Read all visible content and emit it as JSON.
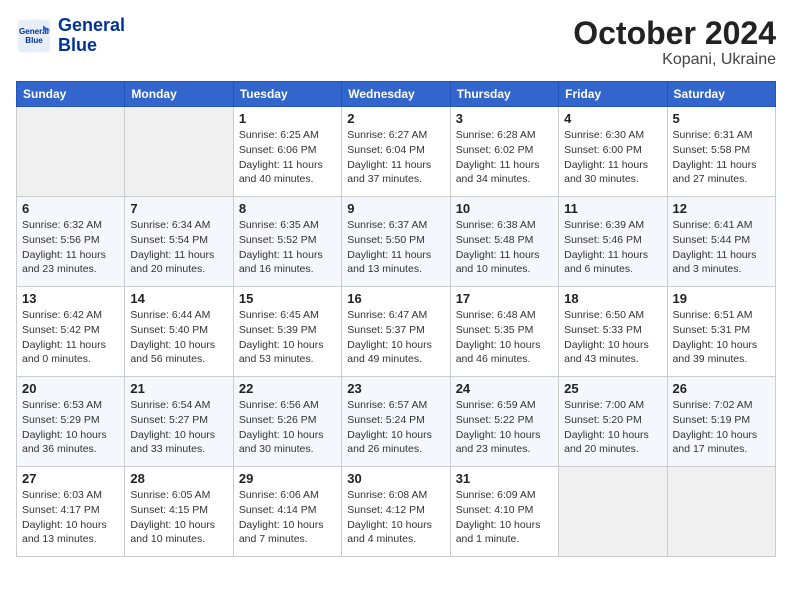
{
  "header": {
    "logo_line1": "General",
    "logo_line2": "Blue",
    "month": "October 2024",
    "location": "Kopani, Ukraine"
  },
  "weekdays": [
    "Sunday",
    "Monday",
    "Tuesday",
    "Wednesday",
    "Thursday",
    "Friday",
    "Saturday"
  ],
  "weeks": [
    [
      {
        "day": "",
        "info": ""
      },
      {
        "day": "",
        "info": ""
      },
      {
        "day": "1",
        "info": "Sunrise: 6:25 AM\nSunset: 6:06 PM\nDaylight: 11 hours and 40 minutes."
      },
      {
        "day": "2",
        "info": "Sunrise: 6:27 AM\nSunset: 6:04 PM\nDaylight: 11 hours and 37 minutes."
      },
      {
        "day": "3",
        "info": "Sunrise: 6:28 AM\nSunset: 6:02 PM\nDaylight: 11 hours and 34 minutes."
      },
      {
        "day": "4",
        "info": "Sunrise: 6:30 AM\nSunset: 6:00 PM\nDaylight: 11 hours and 30 minutes."
      },
      {
        "day": "5",
        "info": "Sunrise: 6:31 AM\nSunset: 5:58 PM\nDaylight: 11 hours and 27 minutes."
      }
    ],
    [
      {
        "day": "6",
        "info": "Sunrise: 6:32 AM\nSunset: 5:56 PM\nDaylight: 11 hours and 23 minutes."
      },
      {
        "day": "7",
        "info": "Sunrise: 6:34 AM\nSunset: 5:54 PM\nDaylight: 11 hours and 20 minutes."
      },
      {
        "day": "8",
        "info": "Sunrise: 6:35 AM\nSunset: 5:52 PM\nDaylight: 11 hours and 16 minutes."
      },
      {
        "day": "9",
        "info": "Sunrise: 6:37 AM\nSunset: 5:50 PM\nDaylight: 11 hours and 13 minutes."
      },
      {
        "day": "10",
        "info": "Sunrise: 6:38 AM\nSunset: 5:48 PM\nDaylight: 11 hours and 10 minutes."
      },
      {
        "day": "11",
        "info": "Sunrise: 6:39 AM\nSunset: 5:46 PM\nDaylight: 11 hours and 6 minutes."
      },
      {
        "day": "12",
        "info": "Sunrise: 6:41 AM\nSunset: 5:44 PM\nDaylight: 11 hours and 3 minutes."
      }
    ],
    [
      {
        "day": "13",
        "info": "Sunrise: 6:42 AM\nSunset: 5:42 PM\nDaylight: 11 hours and 0 minutes."
      },
      {
        "day": "14",
        "info": "Sunrise: 6:44 AM\nSunset: 5:40 PM\nDaylight: 10 hours and 56 minutes."
      },
      {
        "day": "15",
        "info": "Sunrise: 6:45 AM\nSunset: 5:39 PM\nDaylight: 10 hours and 53 minutes."
      },
      {
        "day": "16",
        "info": "Sunrise: 6:47 AM\nSunset: 5:37 PM\nDaylight: 10 hours and 49 minutes."
      },
      {
        "day": "17",
        "info": "Sunrise: 6:48 AM\nSunset: 5:35 PM\nDaylight: 10 hours and 46 minutes."
      },
      {
        "day": "18",
        "info": "Sunrise: 6:50 AM\nSunset: 5:33 PM\nDaylight: 10 hours and 43 minutes."
      },
      {
        "day": "19",
        "info": "Sunrise: 6:51 AM\nSunset: 5:31 PM\nDaylight: 10 hours and 39 minutes."
      }
    ],
    [
      {
        "day": "20",
        "info": "Sunrise: 6:53 AM\nSunset: 5:29 PM\nDaylight: 10 hours and 36 minutes."
      },
      {
        "day": "21",
        "info": "Sunrise: 6:54 AM\nSunset: 5:27 PM\nDaylight: 10 hours and 33 minutes."
      },
      {
        "day": "22",
        "info": "Sunrise: 6:56 AM\nSunset: 5:26 PM\nDaylight: 10 hours and 30 minutes."
      },
      {
        "day": "23",
        "info": "Sunrise: 6:57 AM\nSunset: 5:24 PM\nDaylight: 10 hours and 26 minutes."
      },
      {
        "day": "24",
        "info": "Sunrise: 6:59 AM\nSunset: 5:22 PM\nDaylight: 10 hours and 23 minutes."
      },
      {
        "day": "25",
        "info": "Sunrise: 7:00 AM\nSunset: 5:20 PM\nDaylight: 10 hours and 20 minutes."
      },
      {
        "day": "26",
        "info": "Sunrise: 7:02 AM\nSunset: 5:19 PM\nDaylight: 10 hours and 17 minutes."
      }
    ],
    [
      {
        "day": "27",
        "info": "Sunrise: 6:03 AM\nSunset: 4:17 PM\nDaylight: 10 hours and 13 minutes."
      },
      {
        "day": "28",
        "info": "Sunrise: 6:05 AM\nSunset: 4:15 PM\nDaylight: 10 hours and 10 minutes."
      },
      {
        "day": "29",
        "info": "Sunrise: 6:06 AM\nSunset: 4:14 PM\nDaylight: 10 hours and 7 minutes."
      },
      {
        "day": "30",
        "info": "Sunrise: 6:08 AM\nSunset: 4:12 PM\nDaylight: 10 hours and 4 minutes."
      },
      {
        "day": "31",
        "info": "Sunrise: 6:09 AM\nSunset: 4:10 PM\nDaylight: 10 hours and 1 minute."
      },
      {
        "day": "",
        "info": ""
      },
      {
        "day": "",
        "info": ""
      }
    ]
  ]
}
